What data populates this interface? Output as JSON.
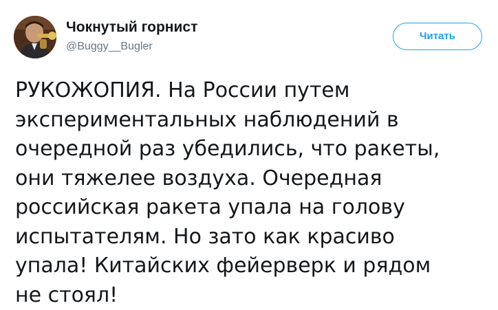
{
  "tweet": {
    "author": {
      "display_name": "Чокнутый горнист",
      "handle": "@Buggy__Bugler",
      "avatar_icon": "avatar-photo"
    },
    "follow_button_label": "Читать",
    "text": "РУКОЖОПИЯ. На России путем\nэкспериментальных наблюдений в\nочередной раз убедились, что ракеты,\nони тяжелее воздуха. Очередная\nроссийская ракета упала на голову\nиспытателям. Но зато как красиво\nупала! Китайских фейерверк и рядом\nне стоял!"
  },
  "colors": {
    "accent": "#1da1f2",
    "text_primary": "#14171a",
    "text_secondary": "#657786",
    "background": "#ffffff"
  }
}
